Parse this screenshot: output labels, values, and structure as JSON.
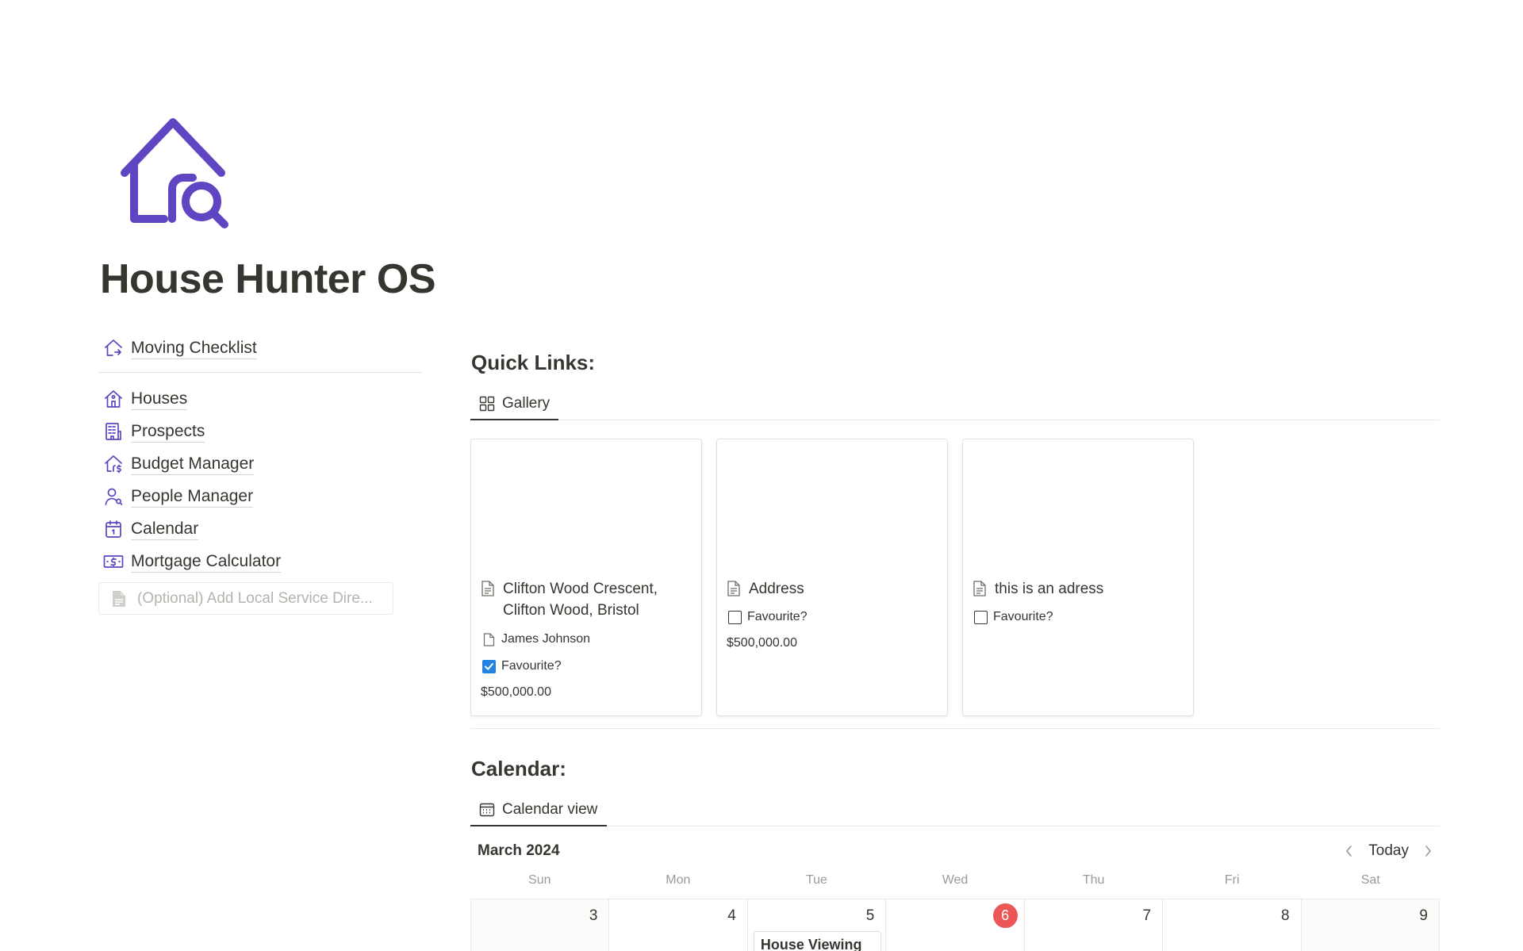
{
  "page": {
    "icon": "house-search-icon",
    "title": "House Hunter OS",
    "accent_color": "#5f45c2"
  },
  "nav": {
    "top_item": {
      "label": "Moving Checklist",
      "icon": "house-arrow-icon"
    },
    "items": [
      {
        "label": "Houses",
        "icon": "house-icon"
      },
      {
        "label": "Prospects",
        "icon": "building-icon"
      },
      {
        "label": "Budget Manager",
        "icon": "house-dollar-icon"
      },
      {
        "label": "People Manager",
        "icon": "person-icon"
      },
      {
        "label": "Calendar",
        "icon": "calendar-icon"
      },
      {
        "label": "Mortgage Calculator",
        "icon": "money-icon"
      }
    ],
    "add_directory": {
      "label": "(Optional) Add Local Service Dire...",
      "icon": "file-icon"
    }
  },
  "quick_links": {
    "title": "Quick Links:",
    "tab_label": "Gallery",
    "cards": [
      {
        "title": "Clifton Wood Crescent, Clifton Wood, Bristol",
        "person": "James Johnson",
        "favourite_label": "Favourite?",
        "favourite": true,
        "price": "$500,000.00"
      },
      {
        "title": "Address",
        "favourite_label": "Favourite?",
        "favourite": false,
        "price": "$500,000.00"
      },
      {
        "title": "this is an adress",
        "favourite_label": "Favourite?",
        "favourite": false
      }
    ]
  },
  "calendar": {
    "title": "Calendar:",
    "tab_label": "Calendar view",
    "month": "March 2024",
    "today_label": "Today",
    "today_color": "#eb5757",
    "weekdays": [
      "Sun",
      "Mon",
      "Tue",
      "Wed",
      "Thu",
      "Fri",
      "Sat"
    ],
    "days": [
      "3",
      "4",
      "5",
      "6",
      "7",
      "8",
      "9"
    ],
    "event": {
      "day": "5",
      "title": "House Viewing"
    }
  }
}
